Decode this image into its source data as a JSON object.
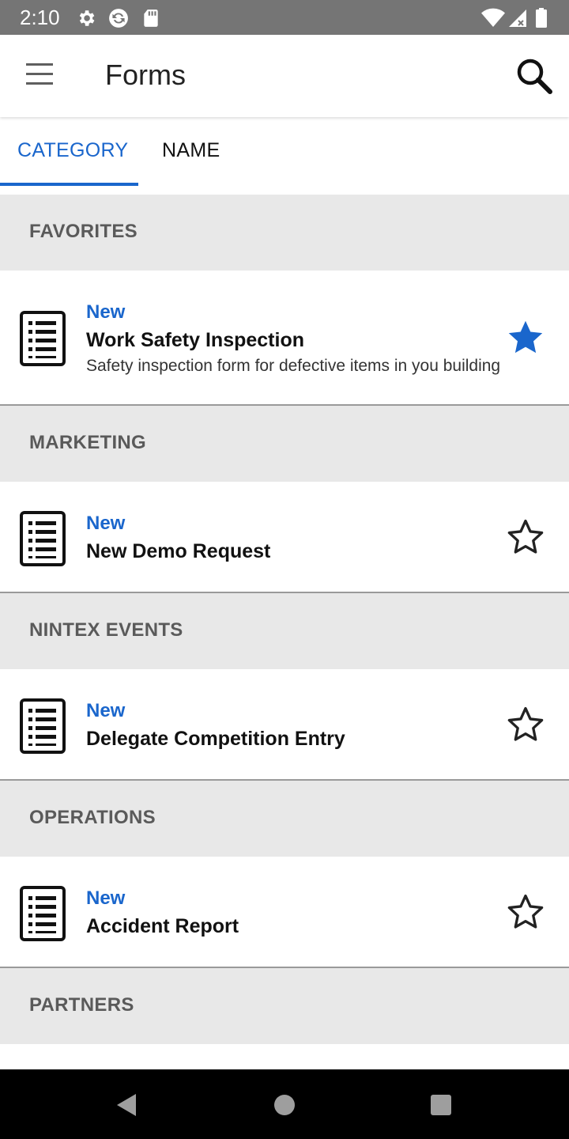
{
  "status_bar": {
    "time": "2:10",
    "icons": [
      "gear-icon",
      "sync-icon",
      "sd-card-icon",
      "wifi-icon",
      "signal-icon",
      "battery-icon"
    ]
  },
  "app_bar": {
    "title": "Forms",
    "menu_icon": "hamburger-menu-icon",
    "search_icon": "search-icon"
  },
  "tabs": [
    {
      "label": "CATEGORY",
      "selected": true
    },
    {
      "label": "NAME",
      "selected": false
    }
  ],
  "sections": [
    {
      "header": "FAVORITES",
      "items": [
        {
          "badge": "New",
          "title": "Work Safety Inspection",
          "description": "Safety inspection form for defective items in you building",
          "favorite": true
        }
      ]
    },
    {
      "header": "MARKETING",
      "items": [
        {
          "badge": "New",
          "title": "New Demo Request",
          "favorite": false
        }
      ]
    },
    {
      "header": "NINTEX EVENTS",
      "items": [
        {
          "badge": "New",
          "title": "Delegate Competition Entry",
          "favorite": false
        }
      ]
    },
    {
      "header": "OPERATIONS",
      "items": [
        {
          "badge": "New",
          "title": "Accident Report",
          "favorite": false
        }
      ]
    },
    {
      "header": "PARTNERS",
      "items": []
    }
  ],
  "colors": {
    "accent": "#1a66cc",
    "status_bar": "#757575",
    "section_bg": "#e8e8e8",
    "nav_bar": "#000000"
  },
  "nav_bar": {
    "icons": [
      "back-icon",
      "home-icon",
      "recents-icon"
    ]
  }
}
